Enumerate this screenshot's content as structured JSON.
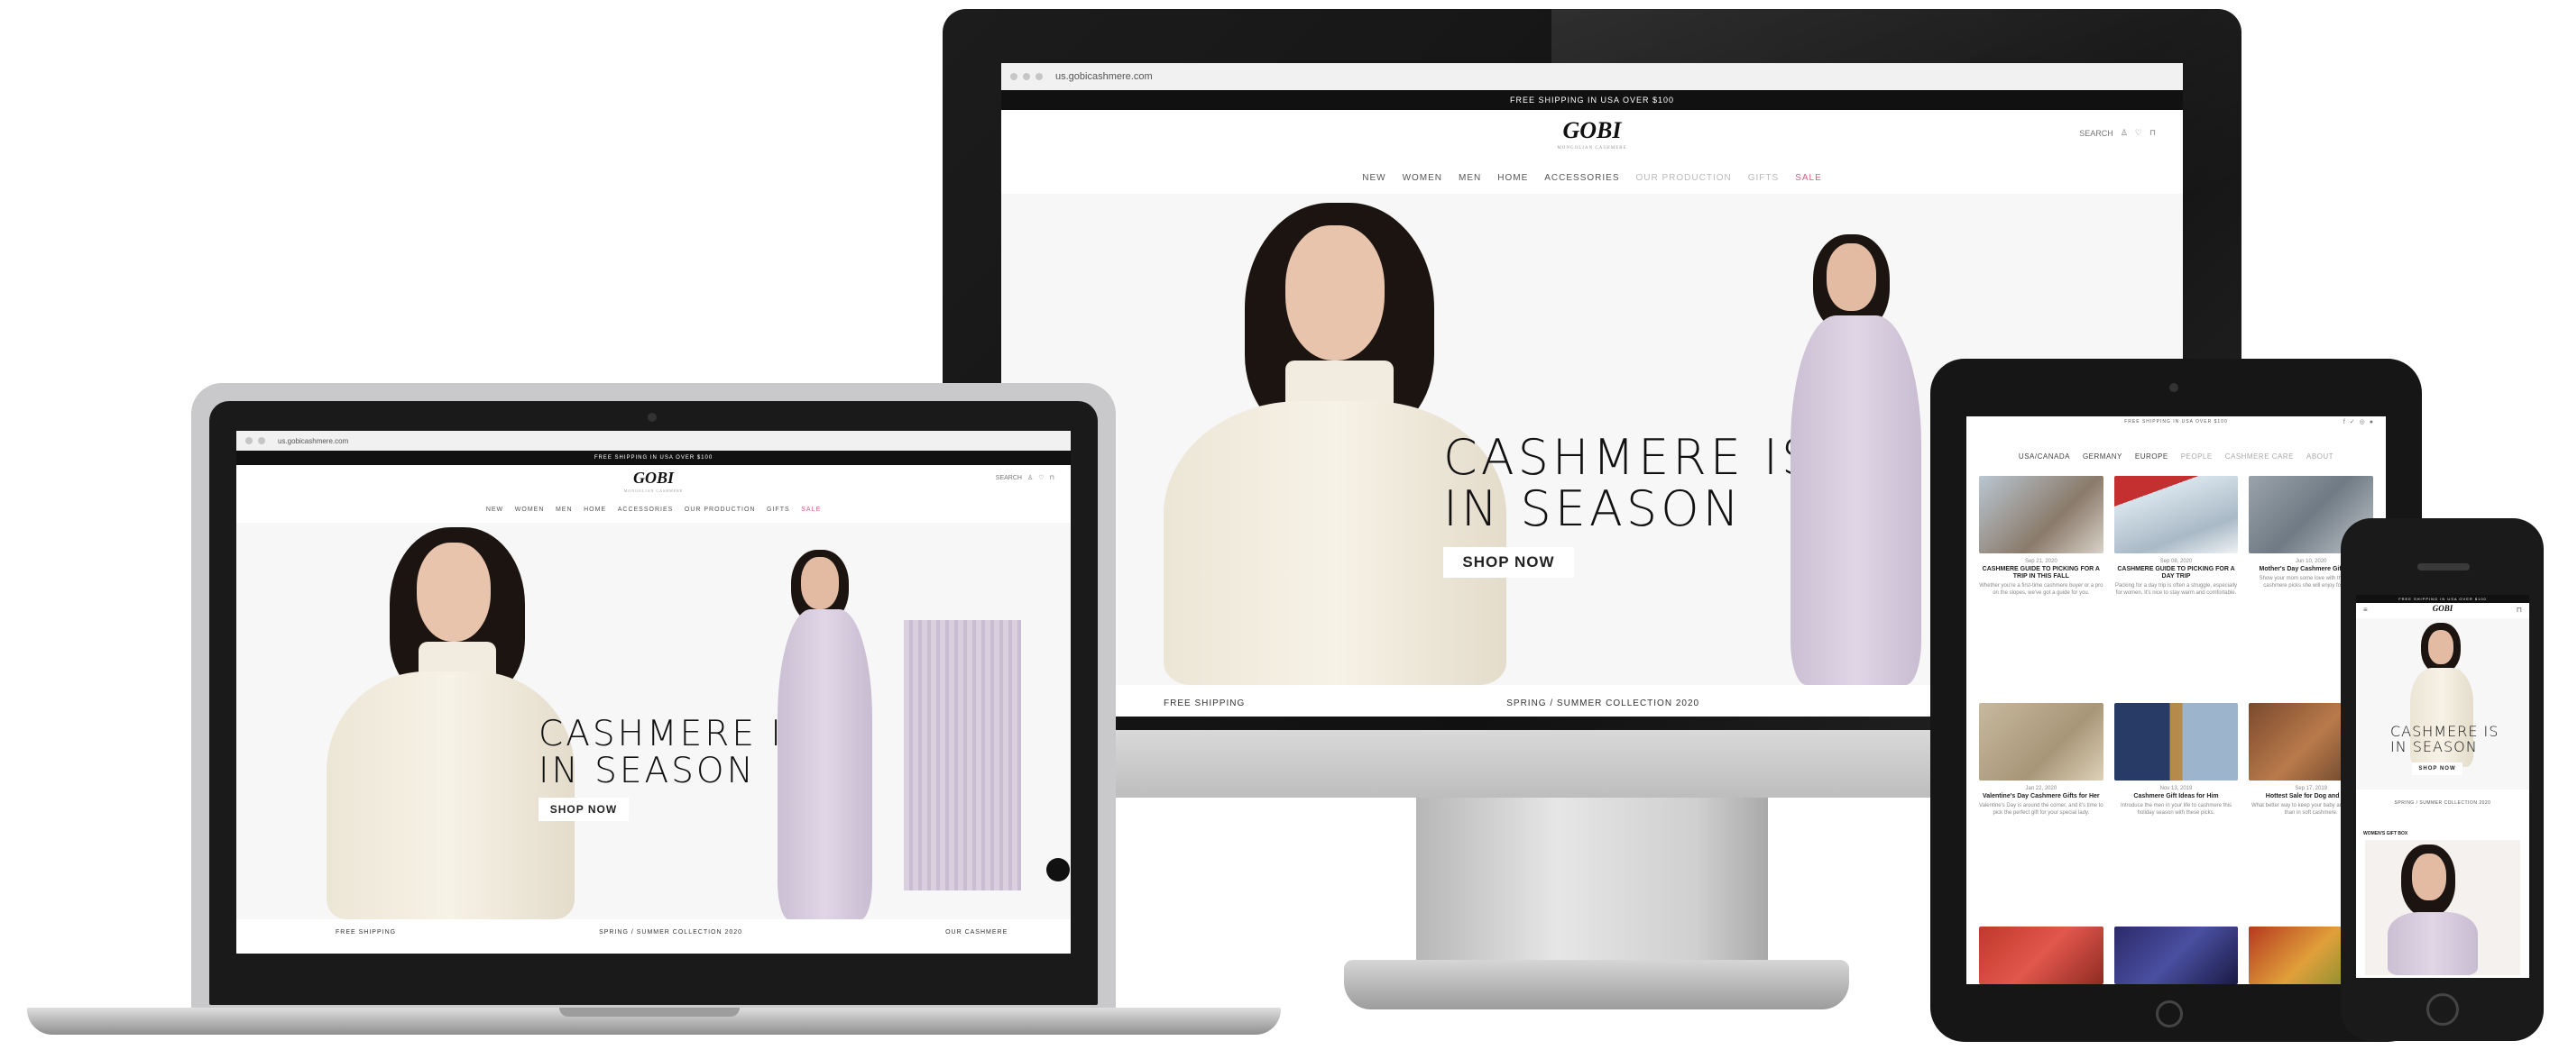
{
  "site": {
    "url": "us.gobicashmere.com",
    "shipping_banner": "FREE SHIPPING IN USA OVER $100",
    "logo": "GOBI",
    "logo_sub": "MONGOLIAN CASHMERE",
    "nav": [
      "NEW",
      "WOMEN",
      "MEN",
      "HOME",
      "ACCESSORIES",
      "OUR PRODUCTION",
      "GIFTS",
      "SALE"
    ],
    "search_label": "SEARCH",
    "headline_line1": "CASHMERE IS",
    "headline_line2": "IN SEASON",
    "shop_now": "SHOP NOW",
    "footer": [
      "FREE SHIPPING",
      "SPRING / SUMMER COLLECTION 2020",
      "OUR CASHMERE"
    ]
  },
  "tablet": {
    "nav": [
      "USA/CANADA",
      "GERMANY",
      "EUROPE",
      "PEOPLE",
      "CASHMERE CARE",
      "ABOUT"
    ],
    "posts": [
      {
        "date": "Sep 21, 2020",
        "title": "CASHMERE GUIDE TO PICKING FOR A TRIP IN THIS FALL",
        "excerpt": "Whether you're a first-time cashmere buyer or a pro on the slopes, we've got a guide for you."
      },
      {
        "date": "Sep 08, 2020",
        "title": "CASHMERE GUIDE TO PICKING FOR A DAY TRIP",
        "excerpt": "Packing for a day trip is often a struggle, especially for women. It's nice to stay warm and comfortable."
      },
      {
        "date": "Jun 10, 2020",
        "title": "Mother's Day Cashmere Gift Guide",
        "excerpt": "Show your mom some love with these cozy cashmere picks she will enjoy for years."
      },
      {
        "date": "Jan 22, 2020",
        "title": "Valentine's Day Cashmere Gifts for Her",
        "excerpt": "Valentine's Day is around the corner, and it's time to pick the perfect gift for your special lady."
      },
      {
        "date": "Nov 13, 2019",
        "title": "Cashmere Gift Ideas for Him",
        "excerpt": "Introduce the men in your life to cashmere this holiday season with these picks."
      },
      {
        "date": "Sep 17, 2019",
        "title": "Hottest Sale for Dog and Baby",
        "excerpt": "What better way to keep your baby and pup warm than in soft cashmere."
      }
    ]
  },
  "phone": {
    "collection": "SPRING / SUMMER COLLECTION 2020",
    "section": "WOMEN'S GIFT BOX"
  },
  "colors": {
    "banner_bg": "#111111",
    "sale": "#e05a7a",
    "sweater": "#f3efe3",
    "dress": "#d8cde0"
  }
}
